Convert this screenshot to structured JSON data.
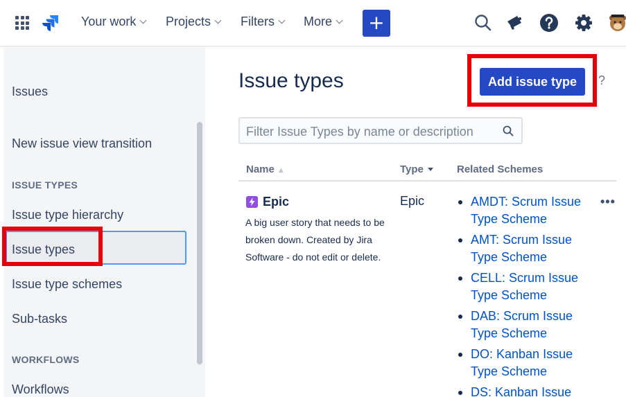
{
  "nav": {
    "items": [
      {
        "label": "Your work"
      },
      {
        "label": "Projects"
      },
      {
        "label": "Filters"
      },
      {
        "label": "More"
      }
    ],
    "create_label": "+"
  },
  "sidebar": {
    "section_title": "Issues",
    "new_issue_view": "New issue view transition",
    "issue_types_heading": "ISSUE TYPES",
    "items": [
      {
        "label": "Issue type hierarchy"
      },
      {
        "label": "Issue types"
      },
      {
        "label": "Issue type schemes"
      },
      {
        "label": "Sub-tasks"
      }
    ],
    "workflows_heading": "WORKFLOWS",
    "workflows_item": "Workflows"
  },
  "main": {
    "title": "Issue types",
    "add_button": "Add issue type",
    "help": "?",
    "filter_placeholder": "Filter Issue Types by name or description",
    "columns": {
      "name": "Name",
      "type": "Type",
      "schemes": "Related Schemes"
    },
    "rows": [
      {
        "name": "Epic",
        "description": "A big user story that needs to be broken down. Created by Jira Software - do not edit or delete.",
        "type": "Epic",
        "schemes": [
          "AMDT: Scrum Issue Type Scheme",
          "AMT: Scrum Issue Type Scheme",
          "CELL: Scrum Issue Type Scheme",
          "DAB: Scrum Issue Type Scheme",
          "DO: Kanban Issue Type Scheme",
          "DS: Kanban Issue"
        ],
        "actions": "•••"
      }
    ]
  },
  "colors": {
    "brand_blue": "#2549c3",
    "highlight_red": "#e5000a",
    "epic_purple": "#904ee2",
    "link_blue": "#0052cc"
  }
}
